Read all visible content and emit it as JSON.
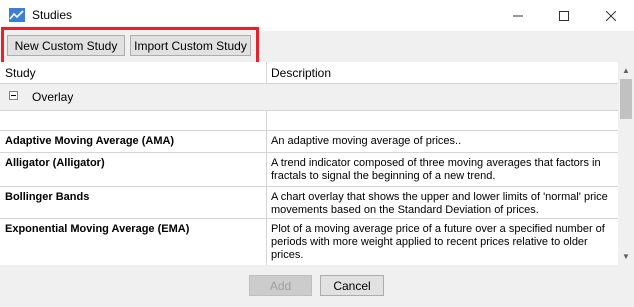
{
  "window": {
    "title": "Studies",
    "minimize_icon": "minimize-icon",
    "maximize_icon": "maximize-icon",
    "close_icon": "close-icon"
  },
  "toolbar": {
    "new_label": "New Custom Study",
    "import_label": "Import Custom Study"
  },
  "grid": {
    "col_study": "Study",
    "col_description": "Description",
    "group_label": "Overlay",
    "rows": [
      {
        "name": "",
        "desc": ""
      },
      {
        "name": "Adaptive Moving Average (AMA)",
        "desc": "An adaptive moving average of prices.."
      },
      {
        "name": "Alligator (Alligator)",
        "desc": "A trend indicator composed of three moving averages that factors in fractals to signal the beginning of a new trend."
      },
      {
        "name": "Bollinger Bands",
        "desc": "A chart overlay that shows the upper and lower limits of 'normal' price movements based on the Standard Deviation of prices."
      },
      {
        "name": "Exponential Moving Average (EMA)",
        "desc": "Plot of a moving average price of a future over a specified number of periods with more weight applied to recent prices relative to older prices."
      }
    ]
  },
  "footer": {
    "add_label": "Add",
    "cancel_label": "Cancel"
  },
  "colors": {
    "highlight": "#e8202a"
  }
}
